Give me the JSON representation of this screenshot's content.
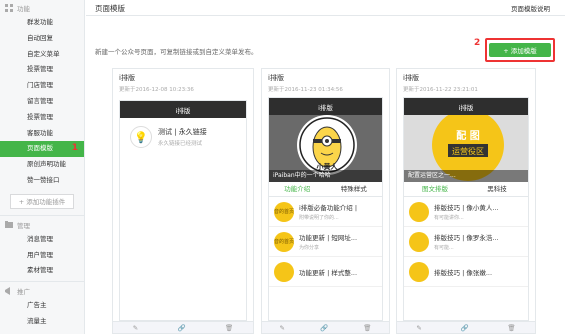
{
  "sidebar": {
    "group1": "功能",
    "items": [
      "群发功能",
      "自动回复",
      "自定义菜单",
      "投票管理",
      "门店管理",
      "留言管理",
      "投票管理",
      "客服功能",
      "页面模版",
      "原创声明功能",
      "赞一赞接口"
    ],
    "active_marker": "1",
    "add_plugin": "+ 添加功能插件",
    "group2": "管理",
    "items2": [
      "消息管理",
      "用户管理",
      "素材管理"
    ],
    "group3": "推广",
    "items3": [
      "广告主",
      "流量主"
    ]
  },
  "header": {
    "title": "页面模版",
    "help": "页面模版说明"
  },
  "main": {
    "description": "新建一个公众号页面，可复制链接或到自定义菜单发布。",
    "add_button": "+ 添加模版",
    "add_marker": "2"
  },
  "cards": [
    {
      "title": "i排版",
      "date": "更新于2016-12-08 10:23:36",
      "bar": "i排版",
      "item_title": "测试 | 永久链接",
      "item_sub": "永久链接已经测试"
    },
    {
      "title": "i排版",
      "date": "更新于2016-11-23 01:34:56",
      "bar": "i排版",
      "hero_caption": "iPaiban中的一个哈哈",
      "hero_badge": "小黄人",
      "tabs": [
        "功能介绍",
        "特殊样式"
      ],
      "articles": [
        {
          "thumb": "音的首页",
          "title": "i排版必备功能介绍 |",
          "sub": "附带说明了你的..."
        },
        {
          "thumb": "音的首页",
          "title": "功能更新 | 短网址...",
          "sub": "为你分享"
        },
        {
          "thumb": "",
          "title": "功能更新 | 样式整...",
          "sub": ""
        }
      ]
    },
    {
      "title": "i排版",
      "date": "更新于2016-11-22 23:21:01",
      "bar": "i排版",
      "hero_line1": "配 图",
      "hero_line2": "运营役区",
      "hero_caption": "配置运营区之一...",
      "tabs": [
        "图文排版",
        "黑科技"
      ],
      "articles": [
        {
          "thumb": "",
          "title": "排版技巧 | 像小黄人...",
          "sub": "有可能讲你..."
        },
        {
          "thumb": "",
          "title": "排版技巧 | 像罗永浩...",
          "sub": "有可能..."
        },
        {
          "thumb": "",
          "title": "排版技巧 | 像张嫩...",
          "sub": ""
        }
      ]
    }
  ],
  "colors": {
    "accent": "#44b549",
    "highlight": "#ee3333",
    "bar": "#2e2e2e",
    "yellow": "#f5c518"
  }
}
